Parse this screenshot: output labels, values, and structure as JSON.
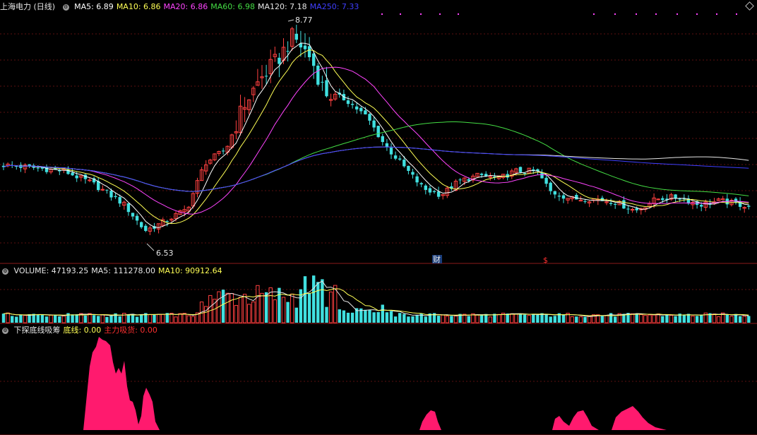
{
  "price_panel": {
    "title": "上海电力 (日线)",
    "legend": [
      {
        "label": "MA5: 6.89",
        "color": "#ffffff"
      },
      {
        "label": "MA10: 6.86",
        "color": "#ffff55"
      },
      {
        "label": "MA20: 6.86",
        "color": "#ff44ff"
      },
      {
        "label": "MA60: 6.98",
        "color": "#44dd44"
      },
      {
        "label": "MA120: 7.18",
        "color": "#e6e6e6"
      },
      {
        "label": "MA250: 7.33",
        "color": "#3f3fff"
      }
    ],
    "high_label": "8.77",
    "low_label": "6.53",
    "marker_cai": "财",
    "marker_dollar": "$"
  },
  "volume_panel": {
    "legend": [
      {
        "label": "VOLUME: 47193.25",
        "color": "#e6e6e6"
      },
      {
        "label": "MA5: 111278.00",
        "color": "#e6e6e6"
      },
      {
        "label": "MA10: 90912.64",
        "color": "#ffff55"
      }
    ]
  },
  "indicator_panel": {
    "legend": [
      {
        "label": "下探底线吸筹",
        "color": "#e6e6e6"
      },
      {
        "label": "底线: 0.00",
        "color": "#ffff55"
      },
      {
        "label": "主力吸货: 0.00",
        "color": "#ff3030"
      }
    ]
  },
  "chart_data": {
    "type": "candlestick",
    "y_range": [
      6.53,
      8.77
    ],
    "colors": {
      "up": "#ff4040",
      "down": "#40e0e0",
      "MA5": "#ffffff",
      "MA10": "#ffff55",
      "MA20": "#ff44ff",
      "MA60": "#44dd44",
      "MA120": "#e6e6e6",
      "MA250": "#3f3fff",
      "indicator_fill": "#ff1a6e"
    }
  }
}
